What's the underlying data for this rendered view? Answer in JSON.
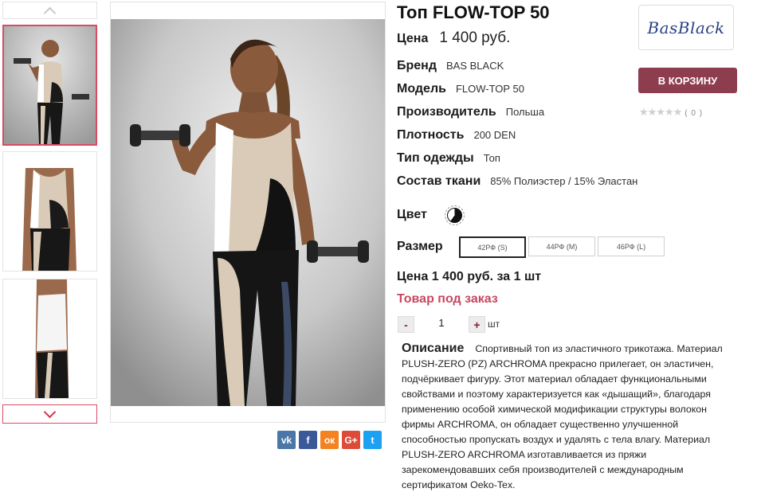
{
  "product": {
    "title": "Топ FLOW-TOP 50",
    "price_label": "Цена",
    "price_value": "1 400 руб.",
    "specs": [
      {
        "label": "Бренд",
        "value": "BAS BLACK"
      },
      {
        "label": "Модель",
        "value": "FLOW-TOP 50"
      },
      {
        "label": "Производитель",
        "value": "Польша"
      },
      {
        "label": "Плотность",
        "value": "200 DEN"
      },
      {
        "label": "Тип одежды",
        "value": "Топ"
      },
      {
        "label": "Состав ткани",
        "value": "85% Полиэстер / 15% Эластан"
      }
    ],
    "color_label": "Цвет",
    "size_label": "Размер",
    "sizes": [
      "42РФ (S)",
      "44РФ (M)",
      "46РФ (L)"
    ],
    "selected_size": "42РФ (S)",
    "unit_price": "Цена 1 400 руб. за 1 шт",
    "availability": "Товар под заказ",
    "quantity": {
      "minus": "-",
      "value": "1",
      "plus": "+",
      "unit": "шт"
    },
    "description_label": "Описание",
    "description": "Спортивный топ из эластичного трикотажа. Материал PLUSH-ZERO (PZ) ARCHROMA прекрасно прилегает, он эластичен, подчёркивает фигуру. Этот материал обладает функциональными свойствами и поэтому характеризуется как «дышащий», благодаря применению особой химической модификации структуры волокон фирмы ARCHROMA, он обладает существенно улучшенной способностью пропускать воздух и удалять с тела влагу. Материал PLUSH-ZERO ARCHROMA изготавливается из пряжи зарекомендовавших себя производителей с международным сертификатом Oeko-Tex."
  },
  "brand_logo": "BasBlack",
  "cart_button": "В КОРЗИНУ",
  "rating": {
    "stars": "★★★★★",
    "count": "( 0 )",
    "value": 0
  },
  "share": [
    {
      "name": "vk-icon",
      "glyph": "vk",
      "color": "#4a76a8"
    },
    {
      "name": "facebook-icon",
      "glyph": "f",
      "color": "#3b5998"
    },
    {
      "name": "odnoklassniki-icon",
      "glyph": "ок",
      "color": "#f58220"
    },
    {
      "name": "google-plus-icon",
      "glyph": "G+",
      "color": "#dd4b39"
    },
    {
      "name": "twitter-icon",
      "glyph": "t",
      "color": "#1da1f2"
    }
  ],
  "colors": {
    "accent": "#d84b63",
    "cart": "#8e3d4f",
    "order": "#c9475f"
  }
}
